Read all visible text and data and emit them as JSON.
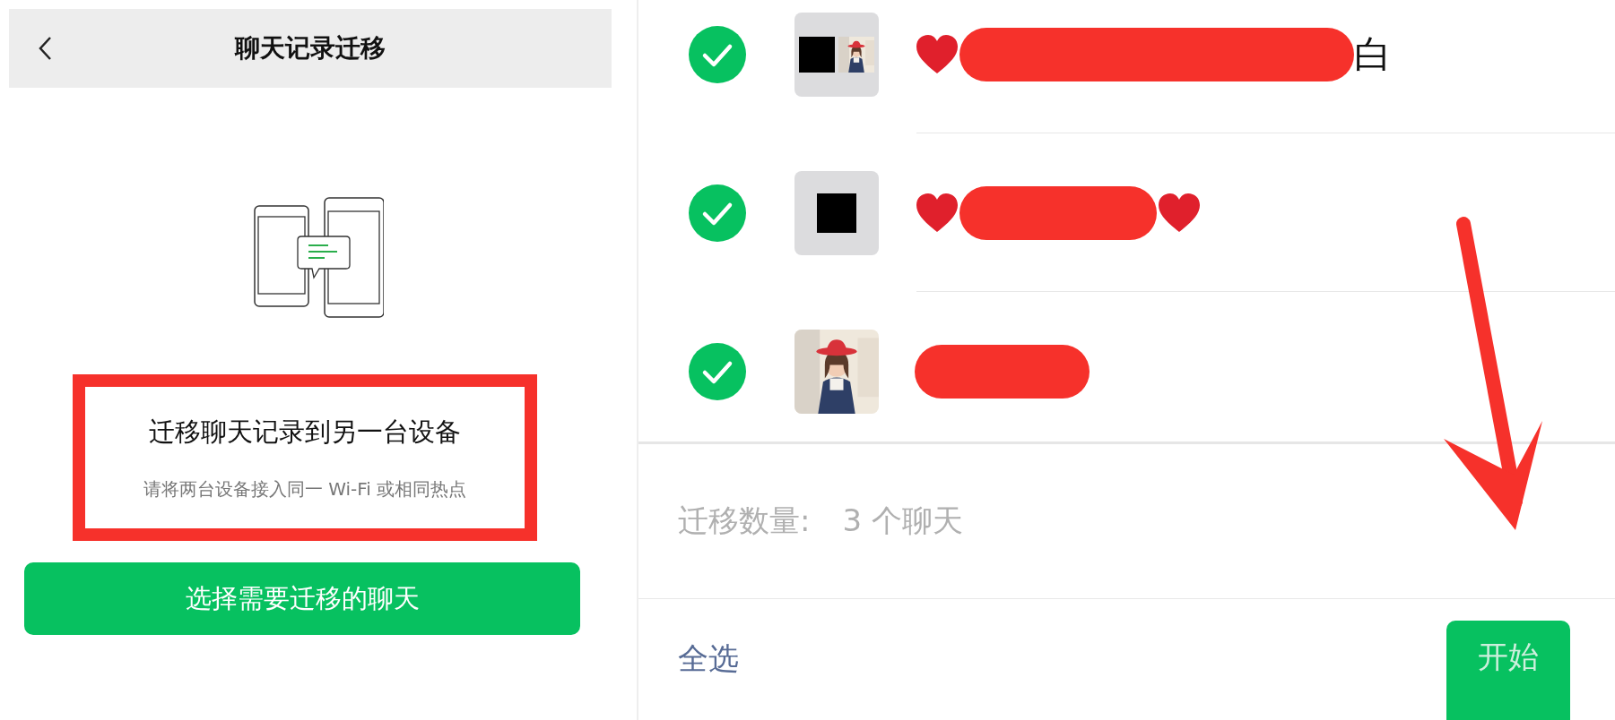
{
  "left": {
    "header": {
      "title": "聊天记录迁移"
    },
    "heading": "迁移聊天记录到另一台设备",
    "hint": "请将两台设备接入同一 Wi-Fi 或相同热点",
    "button": "选择需要迁移的聊天"
  },
  "right": {
    "chats": [
      {
        "checked": true,
        "avatar": {
          "kind": "squares"
        },
        "leading_heart": true,
        "trailing_heart": false,
        "tail": "白"
      },
      {
        "checked": true,
        "avatar": {
          "kind": "square"
        },
        "leading_heart": true,
        "trailing_heart": true
      },
      {
        "checked": true,
        "leading_heart": false,
        "trailing_heart": false
      }
    ],
    "count_label": "迁移数量:",
    "count_value": "3 个聊天",
    "select_all": "全选",
    "start_button": "开始"
  }
}
